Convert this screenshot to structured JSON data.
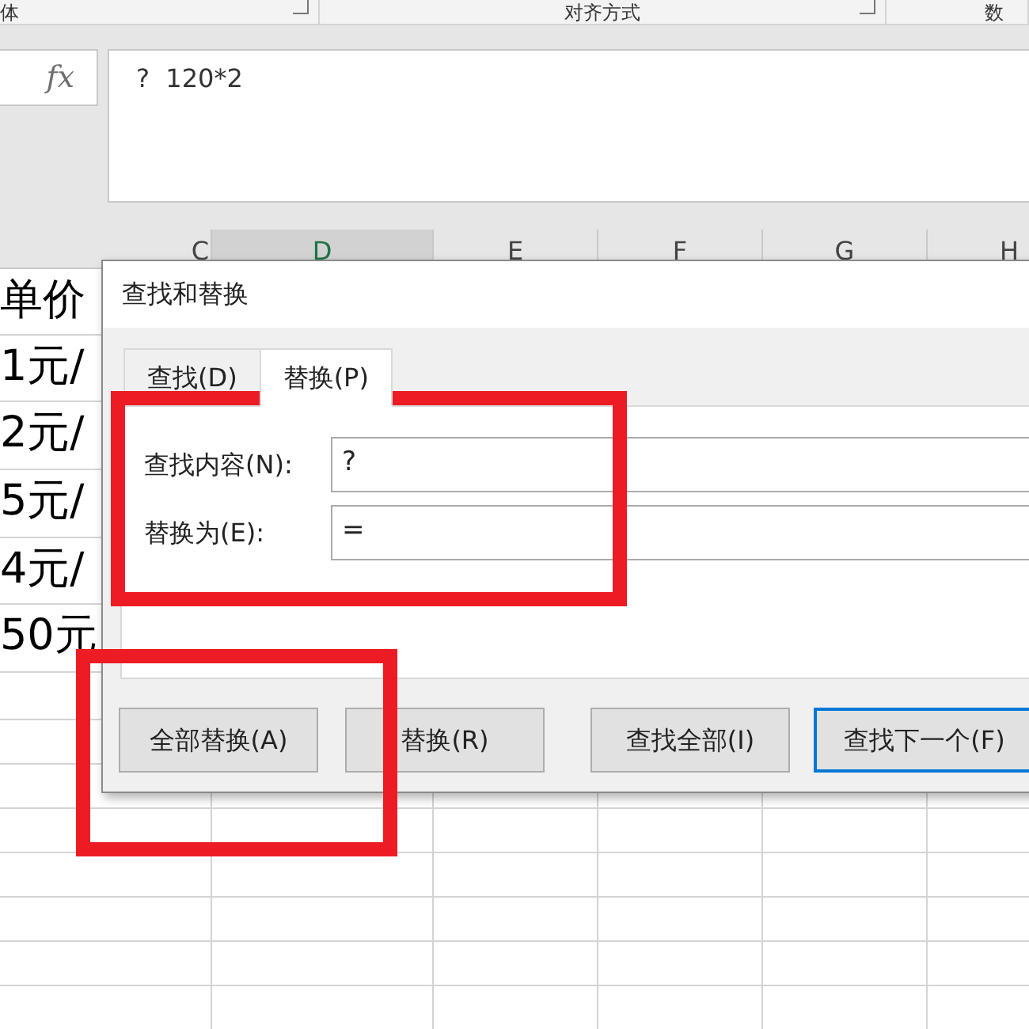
{
  "ribbon": {
    "groups": [
      {
        "label": "体",
        "launcher": true
      },
      {
        "label": "对齐方式",
        "launcher": true
      },
      {
        "label": "数"
      }
    ]
  },
  "formula_bar": {
    "fx": "fx",
    "value": "?  120*2"
  },
  "sheet": {
    "columns": [
      {
        "label": "C",
        "selected": false
      },
      {
        "label": "D",
        "selected": true
      },
      {
        "label": "E",
        "selected": false
      },
      {
        "label": "F",
        "selected": false
      },
      {
        "label": "G",
        "selected": false
      },
      {
        "label": "H",
        "selected": false
      }
    ],
    "cells": [
      "单价",
      "1元/",
      "2元/",
      "5元/",
      "4元/",
      "50元"
    ]
  },
  "dialog": {
    "title": "查找和替换",
    "tabs": [
      {
        "label": "查找(D)",
        "selected": false
      },
      {
        "label": "替换(P)",
        "selected": true
      }
    ],
    "fields": [
      {
        "label": "查找内容(N):",
        "value": "?"
      },
      {
        "label": "替换为(E):",
        "value": "="
      }
    ],
    "buttons": [
      {
        "label": "全部替换(A)",
        "default": false
      },
      {
        "label": "替换(R)",
        "default": false
      },
      {
        "label": "查找全部(I)",
        "default": false
      },
      {
        "label": "查找下一个(F)",
        "default": true
      }
    ]
  },
  "annotations": [
    {
      "kind": "rectangle",
      "color": "#ed1c24"
    },
    {
      "kind": "rectangle",
      "color": "#ed1c24"
    }
  ]
}
